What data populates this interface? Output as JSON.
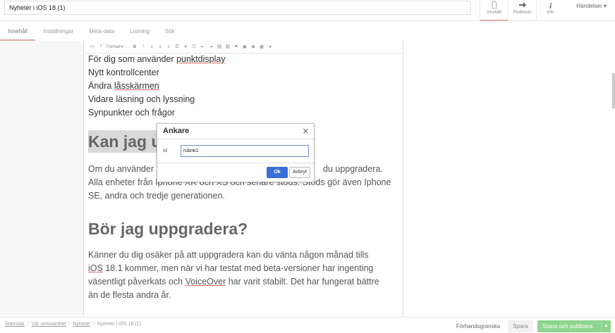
{
  "header": {
    "title_value": "Nyheter i iOS 18 (1)",
    "actions": [
      {
        "label": "Innehåll",
        "icon": "document-icon"
      },
      {
        "label": "Redirects",
        "icon": "arrow-right-icon"
      },
      {
        "label": "Info",
        "icon": "info-icon"
      }
    ],
    "events_label": "Händelser ▾"
  },
  "tabs": [
    "Innehåll",
    "Inställningar",
    "Meta-data",
    "Listning",
    "Sök"
  ],
  "toolbar": {
    "format_label": "Format ▾"
  },
  "content": {
    "list_lines": [
      "För dig som använder ",
      "punktdisplay",
      "Nytt kontrollcenter",
      "Ändra ",
      "låsskärmen",
      "Vidare läsning och lyssning",
      "Synpunkter och frågor"
    ],
    "heading1": "Kan jag u",
    "para1_line1_left": "Om du använder",
    "para1_line1_right": "du uppgradera.",
    "para1_line2": "Alla enheter från Iphone XR och XS och senare stöds. Stöds gör även Iphone",
    "para1_line3": "SE, andra och tredje generationen.",
    "heading2": "Bör jag uppgradera?",
    "para2_line1": "Känner du dig osäker på att uppgradera kan du vänta någon månad tills",
    "para2_line2_a": "iOS",
    "para2_line2_b": " 18.1 kommer, men när vi har testat med beta-versioner har ingenting",
    "para2_line3_a": "väsentligt påverkats och ",
    "para2_line3_b": "VoiceOver",
    "para2_line3_c": " har varit stabilt. Det har fungerat bättre",
    "para2_line4": "än de flesta andra år."
  },
  "modal": {
    "title": "Ankare",
    "close": "✕",
    "id_label": "Id",
    "id_value": "rubrik1",
    "ok_label": "Ok",
    "cancel_label": "Avbryt"
  },
  "footer": {
    "breadcrumbs": [
      "Startsida",
      "Vår verksamhet",
      "Nyheter",
      "Nyheter i iOS 18 (1)"
    ],
    "separator": "/",
    "preview_label": "Förhandsgranska",
    "save_label": "Spara",
    "publish_label": "Spara och publicera",
    "publish_caret": "▲"
  }
}
